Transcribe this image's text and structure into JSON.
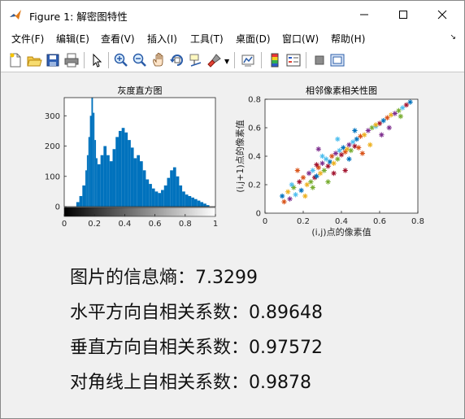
{
  "window": {
    "title": "Figure 1: 解密图特性",
    "controls": {
      "minimize": "—",
      "maximize": "☐",
      "close": "✕"
    }
  },
  "menu": {
    "items": [
      "文件(F)",
      "编辑(E)",
      "查看(V)",
      "插入(I)",
      "工具(T)",
      "桌面(D)",
      "窗口(W)",
      "帮助(H)"
    ],
    "overflow_arrow": "↘"
  },
  "toolbar": {
    "icons": [
      "new-figure-icon",
      "open-file-icon",
      "save-icon",
      "print-icon",
      "pointer-icon",
      "zoom-in-icon",
      "zoom-out-icon",
      "pan-icon",
      "rotate-3d-icon",
      "data-cursor-icon",
      "brush-icon",
      "brush-dropdown-icon",
      "link-plot-icon",
      "insert-colorbar-icon",
      "insert-legend-icon",
      "hide-plot-tools-icon",
      "show-plot-tools-icon"
    ]
  },
  "chart_data": [
    {
      "type": "area",
      "title": "灰度直方图",
      "xlabel": "",
      "ylabel": "",
      "xlim": [
        0,
        1
      ],
      "ylim": [
        0,
        360
      ],
      "xticks": [
        "0",
        "0.2",
        "0.4",
        "0.6",
        "0.8",
        "1"
      ],
      "yticks": [
        "0",
        "100",
        "200",
        "300"
      ],
      "grid": false,
      "color": "#0072bd",
      "x": [
        0.07,
        0.08,
        0.1,
        0.12,
        0.14,
        0.15,
        0.16,
        0.17,
        0.18,
        0.19,
        0.2,
        0.21,
        0.22,
        0.24,
        0.26,
        0.28,
        0.3,
        0.32,
        0.34,
        0.36,
        0.38,
        0.4,
        0.42,
        0.44,
        0.46,
        0.48,
        0.5,
        0.52,
        0.54,
        0.56,
        0.58,
        0.6,
        0.62,
        0.64,
        0.66,
        0.68,
        0.7,
        0.72,
        0.74,
        0.76,
        0.78,
        0.8,
        0.82,
        0.84,
        0.86,
        0.88,
        0.9,
        0.92,
        0.94,
        0.96
      ],
      "values": [
        0,
        15,
        35,
        70,
        120,
        170,
        230,
        300,
        360,
        310,
        220,
        160,
        140,
        170,
        200,
        170,
        150,
        190,
        230,
        250,
        260,
        245,
        220,
        195,
        160,
        170,
        150,
        120,
        90,
        75,
        60,
        50,
        45,
        55,
        70,
        95,
        120,
        130,
        100,
        70,
        50,
        40,
        35,
        30,
        25,
        20,
        15,
        10,
        5,
        0
      ]
    },
    {
      "type": "scatter",
      "title": "相邻像素相关性图",
      "xlabel": "(i,j)点的像素值",
      "ylabel": "(i,j+1)点的像素值",
      "xlim": [
        0,
        0.8
      ],
      "ylim": [
        0,
        0.8
      ],
      "xticks": [
        "0",
        "0.2",
        "0.4",
        "0.6",
        "0.8"
      ],
      "yticks": [
        "0",
        "0.2",
        "0.4",
        "0.6",
        "0.8"
      ],
      "grid": false,
      "marker": "*",
      "colors": [
        "#0072bd",
        "#d95319",
        "#edb120",
        "#7e2f8e",
        "#77ac30",
        "#4dbeee",
        "#a2142f"
      ],
      "x": [
        0.09,
        0.1,
        0.12,
        0.13,
        0.15,
        0.16,
        0.18,
        0.19,
        0.2,
        0.22,
        0.23,
        0.24,
        0.25,
        0.26,
        0.27,
        0.28,
        0.29,
        0.3,
        0.31,
        0.32,
        0.33,
        0.34,
        0.35,
        0.36,
        0.37,
        0.38,
        0.39,
        0.4,
        0.41,
        0.42,
        0.43,
        0.44,
        0.45,
        0.46,
        0.47,
        0.48,
        0.5,
        0.52,
        0.54,
        0.56,
        0.58,
        0.6,
        0.62,
        0.64,
        0.66,
        0.68,
        0.7,
        0.72,
        0.74,
        0.76,
        0.17,
        0.21,
        0.28,
        0.33,
        0.38,
        0.42,
        0.47,
        0.51,
        0.55,
        0.61,
        0.25,
        0.3,
        0.36,
        0.44,
        0.49,
        0.58,
        0.65,
        0.71,
        0.14,
        0.27
      ],
      "y": [
        0.12,
        0.08,
        0.15,
        0.1,
        0.18,
        0.13,
        0.22,
        0.16,
        0.25,
        0.2,
        0.28,
        0.22,
        0.3,
        0.25,
        0.26,
        0.32,
        0.28,
        0.35,
        0.3,
        0.38,
        0.33,
        0.36,
        0.4,
        0.35,
        0.42,
        0.38,
        0.44,
        0.41,
        0.46,
        0.43,
        0.45,
        0.48,
        0.44,
        0.5,
        0.47,
        0.52,
        0.54,
        0.55,
        0.58,
        0.6,
        0.61,
        0.63,
        0.65,
        0.67,
        0.69,
        0.7,
        0.72,
        0.74,
        0.76,
        0.78,
        0.3,
        0.12,
        0.45,
        0.22,
        0.52,
        0.3,
        0.58,
        0.42,
        0.48,
        0.55,
        0.18,
        0.4,
        0.28,
        0.38,
        0.46,
        0.62,
        0.6,
        0.68,
        0.2,
        0.34
      ]
    }
  ],
  "results": {
    "entropy": "图片的信息熵：7.3299",
    "horizontal": "水平方向自相关系数：0.89648",
    "vertical": "垂直方向自相关系数：0.97572",
    "diagonal": "对角线上自相关系数：0.9878"
  }
}
